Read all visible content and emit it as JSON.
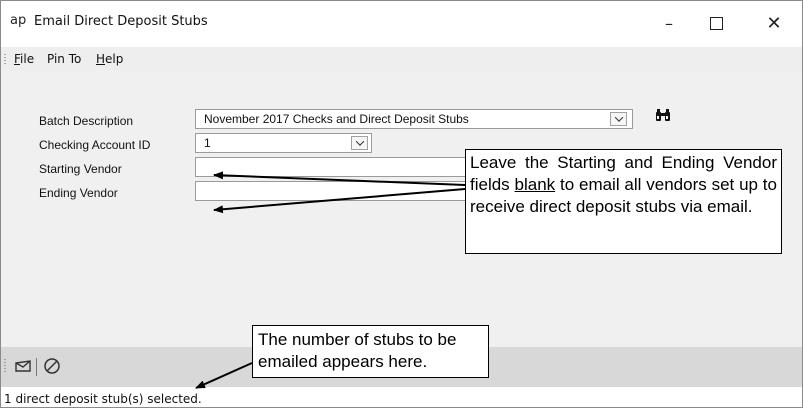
{
  "window": {
    "app_icon": "ap",
    "title": "Email Direct Deposit Stubs",
    "minimize_glyph": "–",
    "close_glyph": "✕"
  },
  "menu": [
    {
      "label": "File",
      "mnemonic": "F",
      "rest": "ile"
    },
    {
      "label": "Pin To"
    },
    {
      "label": "Help",
      "mnemonic": "H",
      "rest": "elp"
    }
  ],
  "form": {
    "batch_description": {
      "label": "Batch Description",
      "value": "November 2017 Checks and Direct Deposit Stubs"
    },
    "checking_account": {
      "label": "Checking Account ID",
      "value": "1"
    },
    "starting_vendor": {
      "label": "Starting Vendor",
      "value": ""
    },
    "ending_vendor": {
      "label": "Ending Vendor",
      "value": ""
    }
  },
  "callouts": {
    "vendor_note_before": "Leave the Starting and Ending Vendor fields ",
    "vendor_note_emphasis": "blank",
    "vendor_note_after": " to email all vendors set up to receive direct deposit stubs via email.",
    "count_note": "The number of stubs to be emailed appears here."
  },
  "toolbar": {
    "icons": [
      "email-icon",
      "cancel-icon"
    ]
  },
  "status": {
    "text": "1 direct deposit stub(s) selected."
  }
}
